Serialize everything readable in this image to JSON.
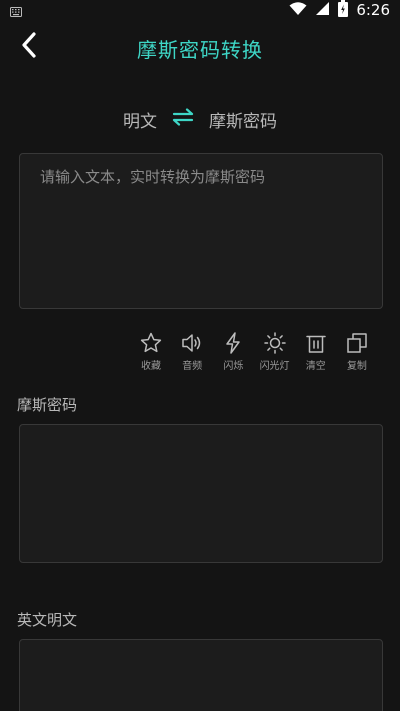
{
  "status_bar": {
    "time": "6:26",
    "icons": [
      "keyboard-icon",
      "wifi-icon",
      "signal-icon",
      "battery-icon"
    ]
  },
  "app_bar": {
    "title": "摩斯密码转换",
    "back_icon": "back-arrow-icon"
  },
  "mode_switch": {
    "left_label": "明文",
    "right_label": "摩斯密码",
    "swap_icon": "swap-arrows-icon"
  },
  "input": {
    "placeholder": "请输入文本，实时转换为摩斯密码",
    "value": ""
  },
  "toolbar": {
    "items": [
      {
        "label": "收藏",
        "icon": "star-icon"
      },
      {
        "label": "音频",
        "icon": "speaker-icon"
      },
      {
        "label": "闪烁",
        "icon": "lightning-icon"
      },
      {
        "label": "闪光灯",
        "icon": "sun-icon"
      },
      {
        "label": "清空",
        "icon": "trash-icon"
      },
      {
        "label": "复制",
        "icon": "copy-icon"
      }
    ]
  },
  "morse_section": {
    "label": "摩斯密码",
    "value": ""
  },
  "english_section": {
    "label": "英文明文",
    "value": ""
  },
  "colors": {
    "accent": "#3ed6c6",
    "background": "#141414",
    "box_background": "#1c1c1c",
    "box_border": "#383838"
  }
}
